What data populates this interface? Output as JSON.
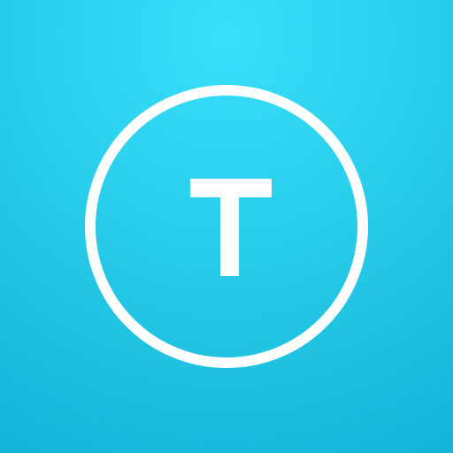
{
  "icon": {
    "logo": "circled-letter-t-logo",
    "mark_letter": "T",
    "colors": {
      "background_top": "#38e0fa",
      "background_bottom": "#13b3d5",
      "mark": "#ffffff"
    }
  }
}
